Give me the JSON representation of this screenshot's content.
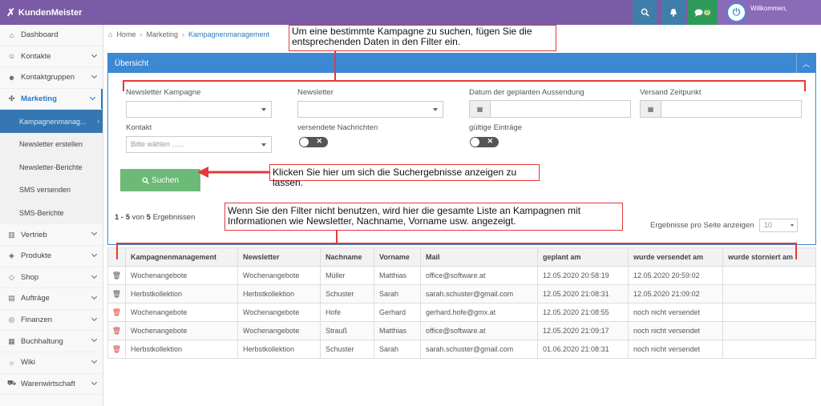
{
  "brand": {
    "name": "KundenMeister"
  },
  "topbar": {
    "chat_badge": "0",
    "welcome": "Willkommen,"
  },
  "sidebar": {
    "items_top": [
      {
        "label": "Dashboard",
        "icon": "home-icon"
      },
      {
        "label": "Kontakte",
        "icon": "contacts-icon"
      },
      {
        "label": "Kontaktgruppen",
        "icon": "groups-icon"
      },
      {
        "label": "Marketing",
        "icon": "marketing-icon",
        "active": true
      }
    ],
    "subitems": [
      {
        "label": "Kampagnenmanag...",
        "active": true
      },
      {
        "label": "Newsletter erstellen"
      },
      {
        "label": "Newsletter-Berichte"
      },
      {
        "label": "SMS versenden"
      },
      {
        "label": "SMS-Berichte"
      }
    ],
    "items_bottom": [
      {
        "label": "Vertrieb",
        "icon": "chart-icon"
      },
      {
        "label": "Produkte",
        "icon": "box-icon"
      },
      {
        "label": "Shop",
        "icon": "tag-icon"
      },
      {
        "label": "Aufträge",
        "icon": "orders-icon"
      },
      {
        "label": "Finanzen",
        "icon": "coins-icon"
      },
      {
        "label": "Buchhaltung",
        "icon": "calculator-icon"
      },
      {
        "label": "Wiki",
        "icon": "bulb-icon"
      },
      {
        "label": "Warenwirtschaft",
        "icon": "cart-icon"
      }
    ]
  },
  "breadcrumb": {
    "home": "Home",
    "section": "Marketing",
    "current": "Kampagnenmanagement"
  },
  "panel": {
    "title": "Übersicht"
  },
  "filters": {
    "campaign_label": "Newsletter Kampagne",
    "newsletter_label": "Newsletter",
    "date_label": "Datum der geplanten Aussendung",
    "time_label": "Versand Zeitpunkt",
    "contact_label": "Kontakt",
    "contact_placeholder": "Bitte wählen ......",
    "sent_label": "versendete Nachrichten",
    "valid_label": "gültige Einträge",
    "search_button": "Suchen"
  },
  "results": {
    "range": "1 - 5",
    "of_text": "von",
    "total": "5",
    "suffix": "Ergebnissen",
    "per_page_label": "Ergebnisse pro Seite anzeigen",
    "per_page_value": "10"
  },
  "table": {
    "columns": [
      "Kampagnenmanagement",
      "Newsletter",
      "Nachname",
      "Vorname",
      "Mail",
      "geplant am",
      "wurde versendet am",
      "wurde storniert am"
    ],
    "rows": [
      {
        "red": false,
        "cells": [
          "Wochenangebote",
          "Wochenangebote",
          "Müller",
          "Matthias",
          "office@software.at",
          "12.05.2020 20:58:19",
          "12.05.2020 20:59:02",
          ""
        ]
      },
      {
        "red": false,
        "cells": [
          "Herbstkollektion",
          "Herbstkollektion",
          "Schuster",
          "Sarah",
          "sarah.schuster@gmail.com",
          "12.05.2020 21:08:31",
          "12.05.2020 21:09:02",
          ""
        ]
      },
      {
        "red": true,
        "cells": [
          "Wochenangebote",
          "Wochenangebote",
          "Hofe",
          "Gerhard",
          "gerhard.hofe@gmx.at",
          "12.05.2020 21:08:55",
          "noch nicht versendet",
          ""
        ]
      },
      {
        "red": true,
        "cells": [
          "Wochenangebote",
          "Wochenangebote",
          "Strauß",
          "Matthias",
          "office@software.at",
          "12.05.2020 21:09:17",
          "noch nicht versendet",
          ""
        ]
      },
      {
        "red": true,
        "cells": [
          "Herbstkollektion",
          "Herbstkollektion",
          "Schuster",
          "Sarah",
          "sarah.schuster@gmail.com",
          "01.06.2020 21:08:31",
          "noch nicht versendet",
          ""
        ]
      }
    ]
  },
  "annotations": {
    "filter_note": "Um eine bestimmte Kampagne zu suchen, fügen Sie die entsprechenden Daten in den Filter ein.",
    "search_note": "Klicken Sie hier um sich die Suchergebnisse anzeigen zu lassen.",
    "list_note": "Wenn Sie den Filter nicht benutzen, wird hier die gesamte Liste an Kampagnen mit Informationen wie Newsletter, Nachname, Vorname usw. angezeigt."
  },
  "colors": {
    "topbar": "#7b5aa6",
    "primary": "#3c88d2",
    "success": "#6dba78",
    "annotation": "#e43939"
  }
}
